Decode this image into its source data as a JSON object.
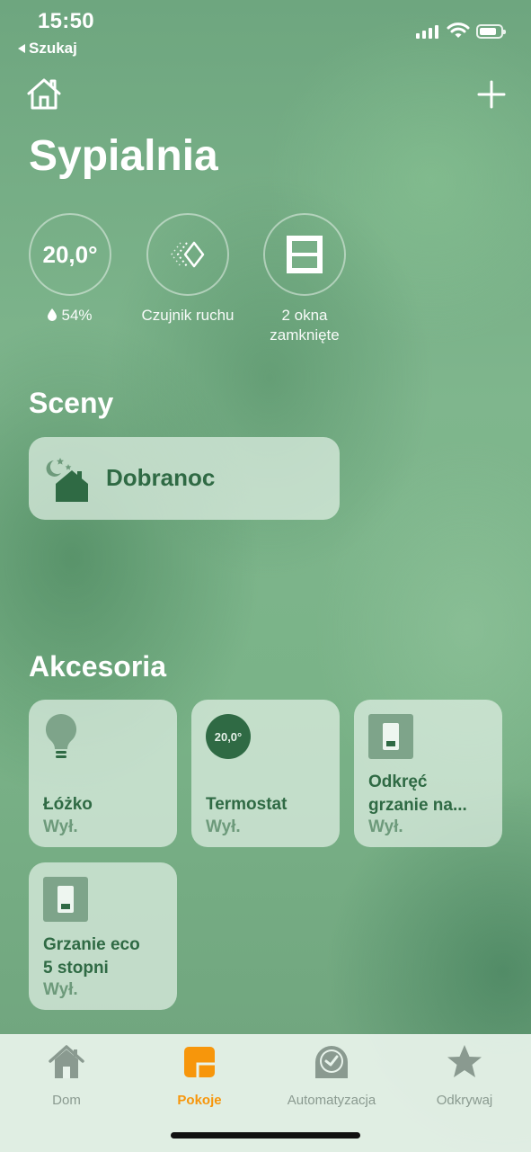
{
  "status_bar": {
    "time": "15:50",
    "back_label": "Szukaj"
  },
  "header": {
    "title": "Sypialnia"
  },
  "status": {
    "temperature": "20,0°",
    "humidity": "54%",
    "motion_label": "Czujnik ruchu",
    "windows_line1": "2 okna",
    "windows_line2": "zamknięte"
  },
  "scenes": {
    "heading": "Sceny",
    "items": [
      {
        "label": "Dobranoc",
        "icon": "night-home-icon"
      }
    ]
  },
  "accessories": {
    "heading": "Akcesoria",
    "items": [
      {
        "name_line1": "Łóżko",
        "name_line2": "",
        "state": "Wył.",
        "icon": "lightbulb-icon"
      },
      {
        "name_line1": "Termostat",
        "name_line2": "",
        "state": "Wył.",
        "icon": "thermostat-icon",
        "badge": "20,0°"
      },
      {
        "name_line1": "Odkręć",
        "name_line2": "grzanie na...",
        "state": "Wył.",
        "icon": "switch-icon"
      },
      {
        "name_line1": "Grzanie eco",
        "name_line2": "5 stopni",
        "state": "Wył.",
        "icon": "switch-icon"
      }
    ]
  },
  "tabbar": {
    "tabs": [
      {
        "label": "Dom",
        "icon": "house-icon",
        "active": false
      },
      {
        "label": "Pokoje",
        "icon": "rooms-icon",
        "active": true
      },
      {
        "label": "Automatyzacja",
        "icon": "clock-icon",
        "active": false
      },
      {
        "label": "Odkrywaj",
        "icon": "star-icon",
        "active": false
      }
    ]
  },
  "colors": {
    "accent": "#f7960b",
    "tile_text": "#2f6a44",
    "background": "#7ab388"
  }
}
